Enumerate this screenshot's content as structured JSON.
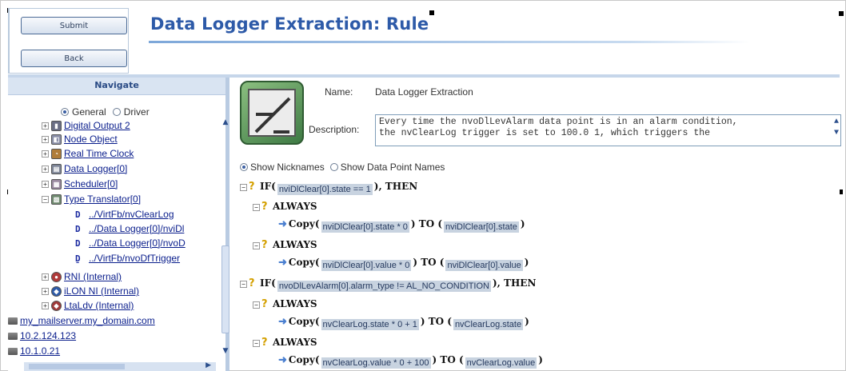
{
  "toolbar": {
    "submit_label": "Submit",
    "back_label": "Back"
  },
  "page": {
    "title": "Data Logger Extraction: Rule"
  },
  "navigate": {
    "header": "Navigate",
    "mode": {
      "general": "General",
      "driver": "Driver",
      "selected": "General"
    },
    "items": [
      {
        "label": "Digital Output 2",
        "icon": "digital-output-icon"
      },
      {
        "label": "Node Object",
        "icon": "node-object-icon"
      },
      {
        "label": "Real Time Clock",
        "icon": "clock-icon"
      },
      {
        "label": "Data Logger[0]",
        "icon": "data-logger-icon"
      },
      {
        "label": "Scheduler[0]",
        "icon": "scheduler-icon"
      },
      {
        "label": "Type Translator[0]",
        "icon": "type-translator-icon"
      },
      {
        "label": "../VirtFb/nvClearLog",
        "icon": "datapoint-icon"
      },
      {
        "label": "../Data Logger[0]/nviDl",
        "icon": "datapoint-icon"
      },
      {
        "label": "../Data Logger[0]/nvoD",
        "icon": "datapoint-icon"
      },
      {
        "label": "../VirtFb/nvoDfTrigger",
        "icon": "datapoint-output-icon"
      },
      {
        "label": "RNI (Internal)",
        "icon": "rni-icon"
      },
      {
        "label": "iLON NI (Internal)",
        "icon": "ilon-ni-icon"
      },
      {
        "label": "LtaLdv (Internal)",
        "icon": "ltaldv-icon"
      },
      {
        "label": "my_mailserver.my_domain.com",
        "icon": "host-icon"
      },
      {
        "label": "10.2.124.123",
        "icon": "host-icon"
      },
      {
        "label": "10.1.0.21",
        "icon": "host-icon"
      }
    ]
  },
  "rule": {
    "name_label": "Name:",
    "name_value": "Data Logger Extraction",
    "description_label": "Description:",
    "description_lines": [
      "Every time the nvoDlLevAlarm data point is in an alarm condition,",
      "the nvClearLog trigger is set to 100.0 1, which triggers the"
    ],
    "show_nicknames": "Show Nicknames",
    "show_datapoint_names": "Show Data Point Names",
    "selected_view": "Show Nicknames"
  },
  "logic": {
    "if1_kw": "IF(",
    "if1_cond": "nviDlClear[0].state == 1",
    "if1_then": "), THEN",
    "always": "ALWAYS",
    "copy_kw": "Copy(",
    "copy1_src": "nviDlClear[0].state * 0",
    "copy1_to": ") TO (",
    "copy1_dst": "nviDlClear[0].state",
    "close": ")",
    "copy2_src": "nviDlClear[0].value * 0",
    "copy2_dst": "nviDlClear[0].value",
    "if2_kw": "IF(",
    "if2_cond": "nvoDlLevAlarm[0].alarm_type != AL_NO_CONDITION",
    "if2_then": "), THEN",
    "copy3_src": "nvClearLog.state * 0 + 1",
    "copy3_dst": "nvClearLog.state",
    "copy4_src": "nvClearLog.value * 0 + 100",
    "copy4_dst": "nvClearLog.value"
  }
}
